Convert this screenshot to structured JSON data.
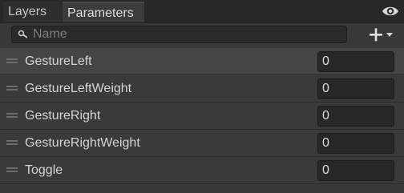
{
  "tabs": [
    {
      "label": "Layers",
      "active": false
    },
    {
      "label": "Parameters",
      "active": true
    }
  ],
  "toolbar": {
    "visibility_icon": "eye-icon",
    "search_placeholder": "Name",
    "search_value": "",
    "add_icon": "plus-icon",
    "add_dropdown_icon": "caret-down-icon"
  },
  "parameters": [
    {
      "name": "GestureLeft",
      "value": "0"
    },
    {
      "name": "GestureLeftWeight",
      "value": "0"
    },
    {
      "name": "GestureRight",
      "value": "0"
    },
    {
      "name": "GestureRightWeight",
      "value": "0"
    },
    {
      "name": "Toggle",
      "value": "0"
    }
  ],
  "colors": {
    "panel_bg": "#383838",
    "tabbar_bg": "#282828",
    "row_bg": "#3a3a3a",
    "row_selected_bg": "#454545",
    "field_bg": "#272727",
    "text": "#d4d4d4"
  }
}
